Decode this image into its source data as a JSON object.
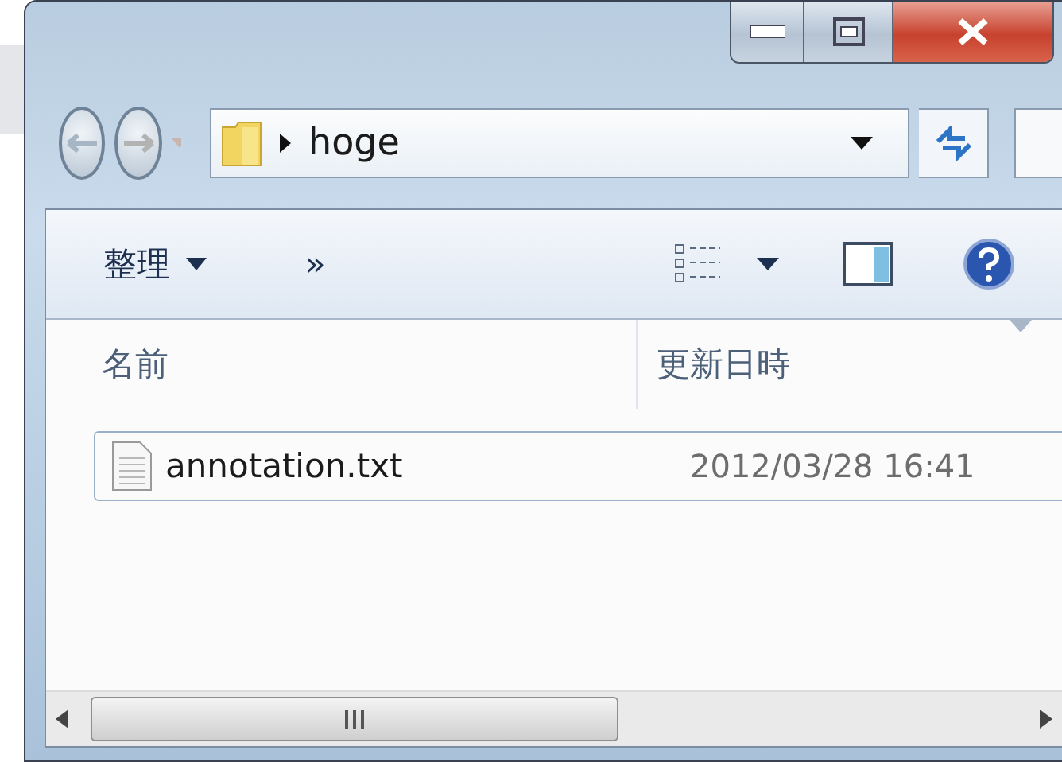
{
  "address_bar": {
    "path": "hoge"
  },
  "command_bar": {
    "items": [
      {
        "kind": "menu",
        "label": "整理"
      },
      {
        "kind": "more",
        "label": "»"
      }
    ]
  },
  "file_list": {
    "columns": [
      {
        "label": "名前",
        "sorted": false
      },
      {
        "label": "更新日時",
        "sorted": true
      }
    ],
    "rows": [
      {
        "name": "annotation.txt",
        "modified": "2012/03/28 16:41",
        "focused": true
      }
    ]
  }
}
